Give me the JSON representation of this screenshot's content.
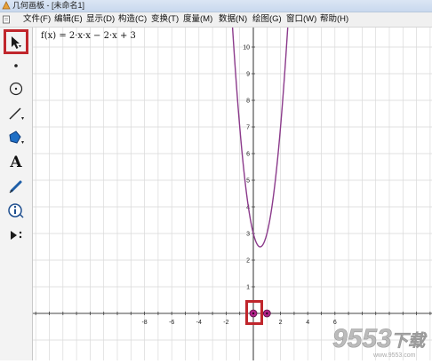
{
  "window": {
    "title": "几何画板 - [未命名1]"
  },
  "menu": {
    "items": [
      "文件(F)",
      "编辑(E)",
      "显示(D)",
      "构造(C)",
      "变换(T)",
      "度量(M)",
      "数据(N)",
      "绘图(G)",
      "窗口(W)",
      "帮助(H)"
    ]
  },
  "toolbox": {
    "tools": [
      "select-arrow-tool",
      "point-tool",
      "compass-tool",
      "straightedge-tool",
      "polygon-tool",
      "text-tool",
      "marker-tool",
      "information-tool",
      "custom-tool"
    ],
    "text_tool_glyph": "A"
  },
  "graph": {
    "function_label": "f(x) = 2·x·x − 2·x + 3",
    "x_tick_labels": [
      "-8",
      "-6",
      "-4",
      "-2",
      "2",
      "4",
      "6"
    ],
    "y_tick_labels": [
      "1",
      "2",
      "3",
      "4",
      "5",
      "6",
      "7",
      "8",
      "9",
      "10"
    ],
    "curve_color": "#8b3a8b",
    "point_color": "#b1238a",
    "points": [
      {
        "x": 0,
        "y": 0
      },
      {
        "x": 1,
        "y": 0
      }
    ]
  },
  "watermark": {
    "text": "9553下载",
    "site": "www.9553.com"
  },
  "colors": {
    "highlight": "#c0262c",
    "grid": "#d9d9d9"
  }
}
